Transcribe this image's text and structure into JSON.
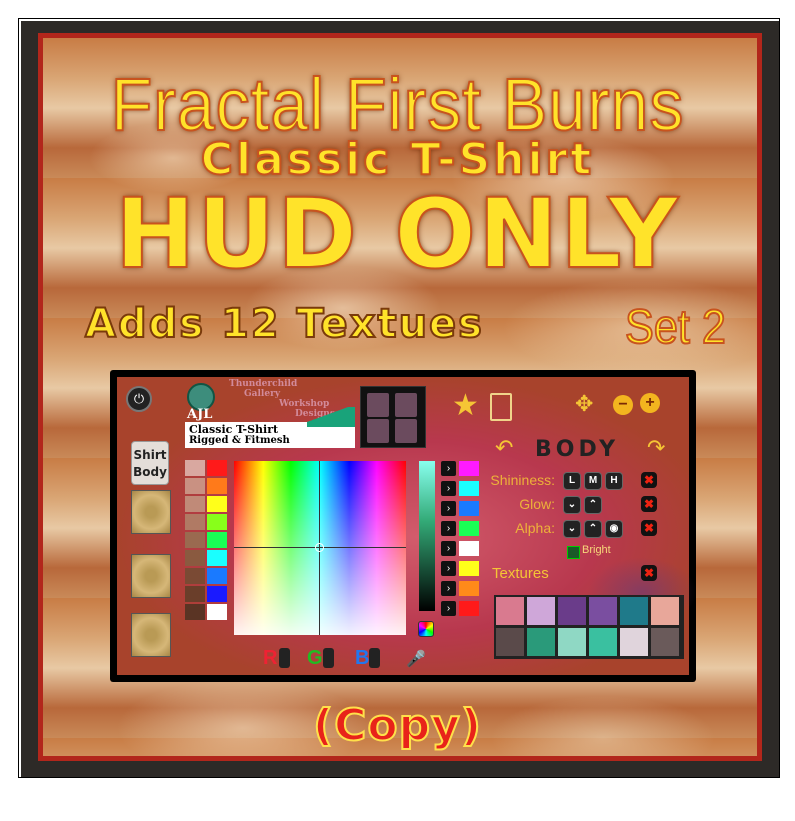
{
  "poster": {
    "title_line1": "Fractal First Burns",
    "title_line2": "Classic T-Shirt",
    "title_line3": "HUD ONLY",
    "adds_text": "Adds 12 Textues",
    "set_text": "Set 2",
    "copy_text": "(Copy)"
  },
  "hud": {
    "logo": {
      "brand_line1": "Thunderchild",
      "brand_line2": "Gallery",
      "brand_line3": "Workshop",
      "brand_line4": "Designs",
      "initials": "AJL",
      "product_line1": "Classic T-Shirt",
      "product_line2": "Rigged & Fitmesh"
    },
    "tab_shirt_body": "Shirt Body",
    "section_title": "BODY",
    "shininess_label": "Shininess:",
    "shininess_keys": [
      "L",
      "M",
      "H"
    ],
    "glow_label": "Glow:",
    "alpha_label": "Alpha:",
    "bright_label": "Bright",
    "textures_label": "Textures",
    "rgb": {
      "r": "R",
      "g": "G",
      "b": "B"
    },
    "colors": {
      "accent": "#f5c535",
      "panel": "#b84050",
      "frame": "#b2261b"
    }
  }
}
